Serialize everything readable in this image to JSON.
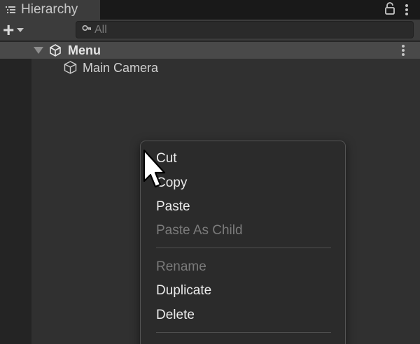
{
  "panel": {
    "title": "Hierarchy"
  },
  "toolbar": {
    "add_label": "+",
    "search_placeholder": "All"
  },
  "hierarchy": {
    "scene_name": "Menu",
    "items": [
      {
        "label": "Main Camera",
        "icon": "cube-icon"
      }
    ]
  },
  "context_menu": {
    "items": [
      {
        "label": "Cut",
        "enabled": true
      },
      {
        "label": "Copy",
        "enabled": true
      },
      {
        "label": "Paste",
        "enabled": true
      },
      {
        "label": "Paste As Child",
        "enabled": false
      },
      {
        "label": "Rename",
        "enabled": false
      },
      {
        "label": "Duplicate",
        "enabled": true
      },
      {
        "label": "Delete",
        "enabled": true
      }
    ]
  },
  "colors": {
    "panel_bg": "#303030",
    "toolbar_bg": "#3c3c3c",
    "scene_row_bg": "#494949",
    "menu_bg": "#2b2b2b",
    "disabled_text": "#7b7b7b"
  }
}
